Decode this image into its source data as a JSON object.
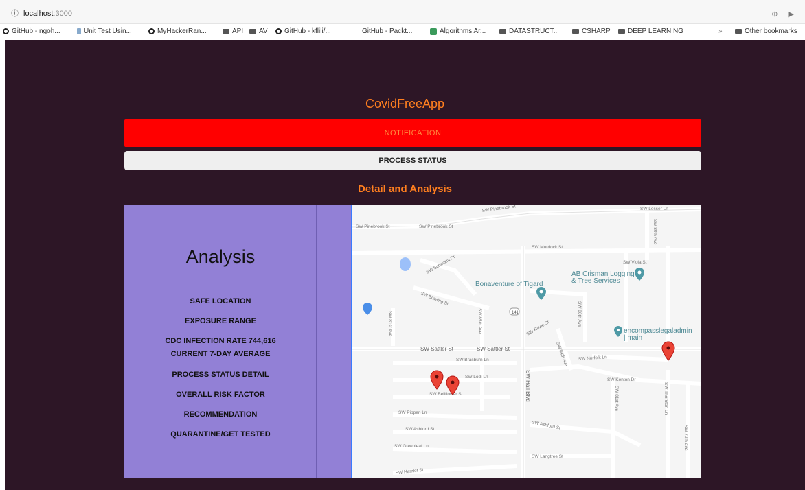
{
  "browser": {
    "host": "localhost",
    "port": ":3000",
    "right_icons": "⊕ ▶",
    "bookmarks": [
      {
        "label": "GitHub - ngoh...",
        "icon": "github-icon"
      },
      {
        "label": "Unit Test Usin...",
        "icon": "page-icon"
      },
      {
        "label": "MyHackerRan...",
        "icon": "github-icon"
      },
      {
        "label": "API",
        "icon": "folder-icon"
      },
      {
        "label": "AV",
        "icon": "folder-icon"
      },
      {
        "label": "GitHub - kflili/...",
        "icon": "github-icon"
      },
      {
        "label": "GitHub - Packt...",
        "icon": "none"
      },
      {
        "label": "Algorithms Ar...",
        "icon": "green-icon"
      },
      {
        "label": "DATASTRUCT...",
        "icon": "folder-icon"
      },
      {
        "label": "CSHARP",
        "icon": "folder-icon"
      },
      {
        "label": "DEEP LEARNING",
        "icon": "folder-icon"
      },
      {
        "label": "Other bookmarks",
        "icon": "folder-icon"
      }
    ],
    "overflow": "»"
  },
  "app": {
    "title": "CovidFreeApp",
    "notification_button": "NOTIFICATION",
    "process_status_button": "PROCESS STATUS",
    "section_title": "Detail and Analysis",
    "colors": {
      "background": "#2d1626",
      "accent": "#ff7f1f",
      "notification": "#ff0000",
      "panel": "#9280d6"
    }
  },
  "analysis": {
    "title": "Analysis",
    "items": [
      "SAFE LOCATION",
      "EXPOSURE RANGE",
      "CDC INFECTION RATE 744,616",
      "CURRENT 7-DAY AVERAGE",
      "PROCESS STATUS DETAIL",
      "OVERALL RISK FACTOR",
      "RECOMMENDATION",
      "QUARANTINE/GET TESTED"
    ]
  },
  "map": {
    "streets": [
      "SW Pinebrook St",
      "SW Pinebrook St",
      "SW Pinebrook St",
      "SW Murdock St",
      "SW Viola St",
      "SW Sattler St",
      "SW Sattler St",
      "SW Brasburn Ln",
      "SW Lodi Ln",
      "SW Bellflower St",
      "SW Pippen Ln",
      "SW Ashford St",
      "SW Greenleaf Ln",
      "SW Hamlet St",
      "SW Norfolk Ln",
      "SW Kenton Dr",
      "SW Langtree St",
      "SW Hall Blvd",
      "SW 81st Ave",
      "SW 85th Ave",
      "SW 84th Ave",
      "SW Lesser Ln",
      "SW Thornton Ln",
      "SW 79th Ave",
      "SW Ashford St",
      "SW 81st Ave",
      "SW Rowe St",
      "SW Scheckla Dr",
      "SW Bowling St",
      "SW 80th Ave",
      "SW 86th Ave"
    ],
    "places": [
      {
        "name": "AB Crisman Logging\n& Tree Services"
      },
      {
        "name": "Bonaventure of Tigard"
      },
      {
        "name": "encompasslegaladmin\n| main"
      }
    ],
    "shield": "141"
  }
}
